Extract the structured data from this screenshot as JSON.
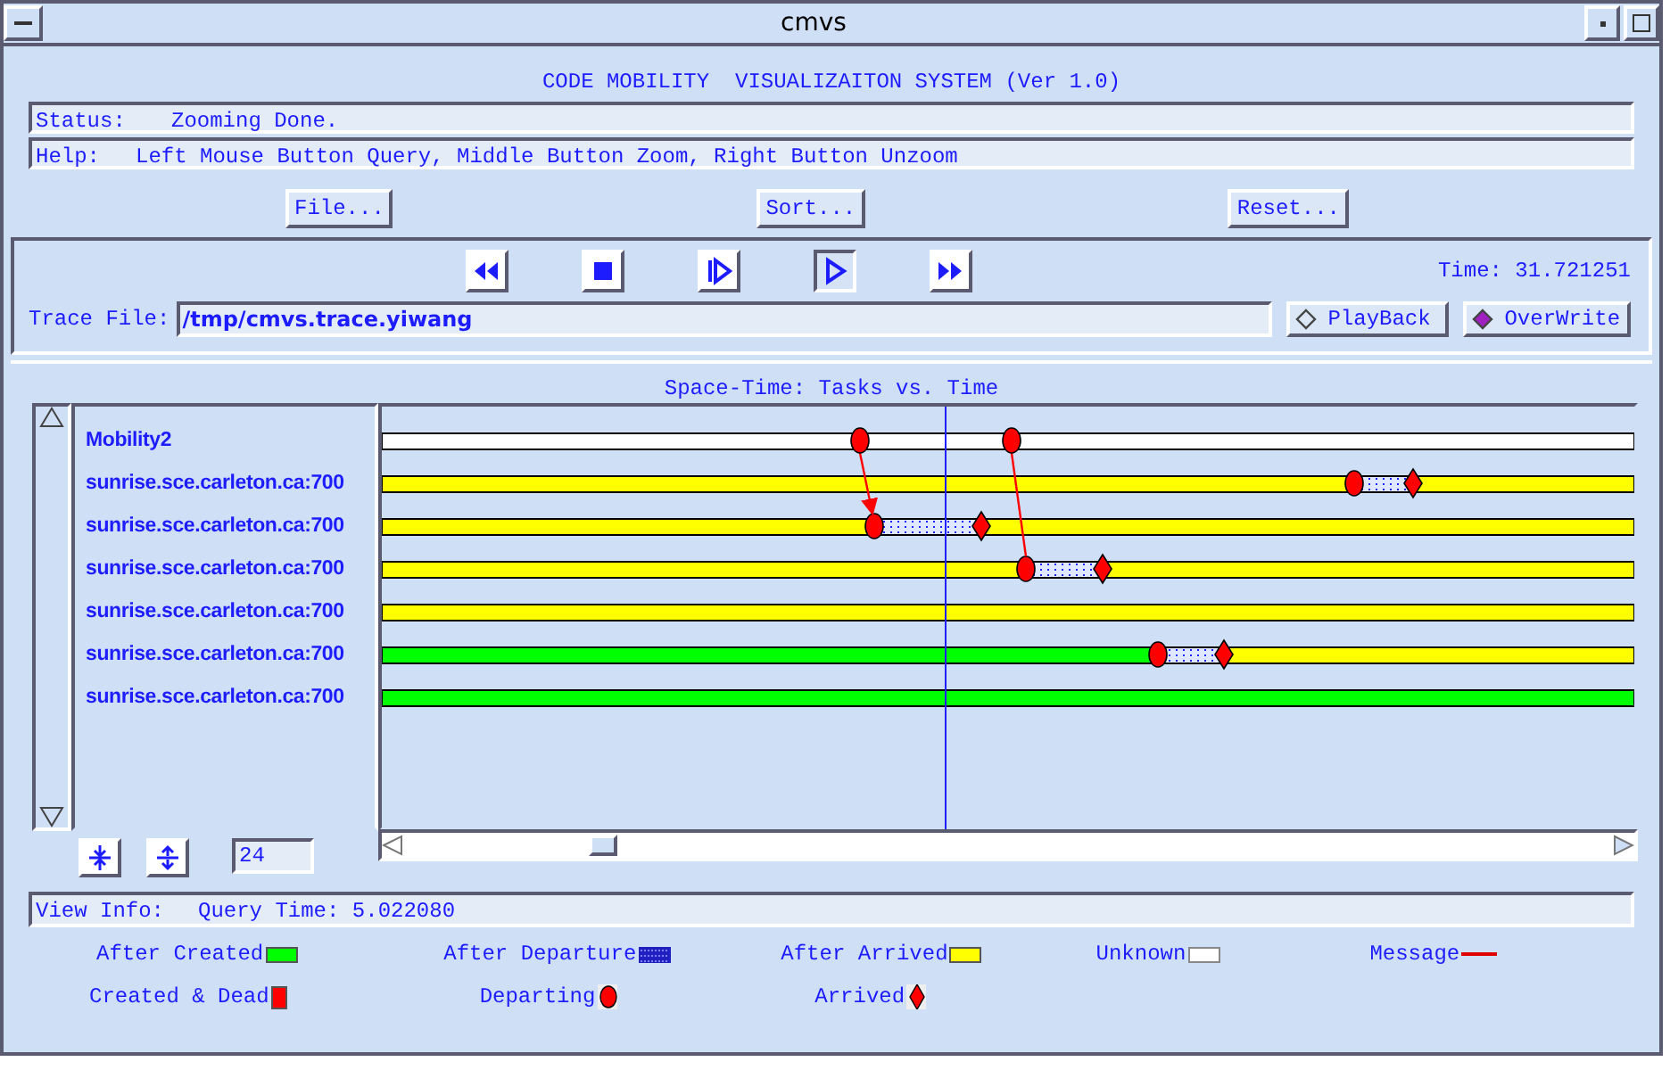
{
  "window": {
    "title": "cmvs"
  },
  "heading": "CODE MOBILITY  VISUALIZAITON SYSTEM (Ver 1.0)",
  "status": {
    "label": "Status:",
    "value": "Zooming Done."
  },
  "help": {
    "label": "Help:",
    "value": "Left Mouse Button Query, Middle Button Zoom, Right Button Unzoom"
  },
  "menu_buttons": [
    "File...",
    "Sort...",
    "Reset..."
  ],
  "player": [
    {
      "kind": "rewind",
      "selected": false
    },
    {
      "kind": "stop",
      "selected": false
    },
    {
      "kind": "step",
      "selected": false
    },
    {
      "kind": "play",
      "selected": true
    },
    {
      "kind": "forward",
      "selected": false
    }
  ],
  "time": "Time: 31.721251",
  "trace_file": {
    "label": "Trace File:",
    "value": "/tmp/cmvs.trace.yiwang"
  },
  "options": [
    {
      "label": "PlayBack",
      "checked": false
    },
    {
      "label": "OverWrite",
      "checked": true
    }
  ],
  "chart_title": "Space-Time: Tasks vs. Time",
  "tasks": [
    {
      "label": "Mobility2"
    },
    {
      "label": "sunrise.sce.carleton.ca:700"
    },
    {
      "label": "sunrise.sce.carleton.ca:700"
    },
    {
      "label": "sunrise.sce.carleton.ca:700"
    },
    {
      "label": "sunrise.sce.carleton.ca:700"
    },
    {
      "label": "sunrise.sce.carleton.ca:700"
    },
    {
      "label": "sunrise.sce.carleton.ca:700"
    }
  ],
  "zoom_value": "24",
  "view_info": {
    "label": "View Info:",
    "value": "Query Time: 5.022080"
  },
  "legend": [
    [
      {
        "label": "After Created",
        "kind": "created"
      },
      {
        "label": "After Departure",
        "kind": "departure"
      },
      {
        "label": "After Arrived",
        "kind": "arrived"
      },
      {
        "label": "Unknown",
        "kind": "unknown"
      },
      {
        "label": "Message",
        "kind": "message"
      }
    ],
    [
      {
        "label": "Created & Dead",
        "kind": "dead"
      },
      {
        "label": "Departing",
        "kind": "departing"
      },
      {
        "label": "Arrived",
        "kind": "arrival"
      }
    ]
  ]
}
